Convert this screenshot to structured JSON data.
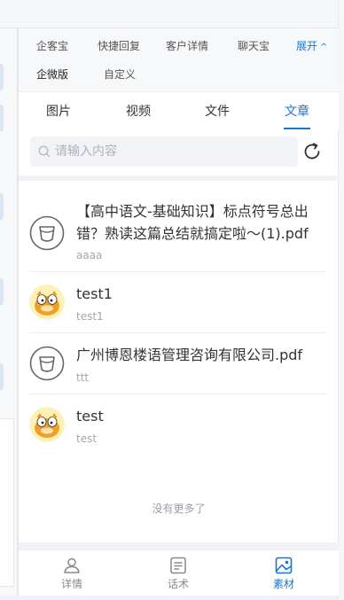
{
  "tools": {
    "row1": [
      "企客宝",
      "快捷回复",
      "客户详情",
      "聊天宝"
    ],
    "expand_label": "展开",
    "row2": [
      "企微版",
      "自定义"
    ]
  },
  "media_tabs": [
    "图片",
    "视频",
    "文件",
    "文章"
  ],
  "active_media_tab": "文章",
  "search": {
    "placeholder": "请输入内容",
    "value": ""
  },
  "items": [
    {
      "title": "【高中语文-基础知识】标点符号总出错？熟读这篇总结就搞定啦～(1).pdf",
      "subtitle": "aaaa",
      "avatar": "file-cup-icon"
    },
    {
      "title": "test1",
      "subtitle": "test1",
      "avatar": "garfield-avatar"
    },
    {
      "title": "广州博恩楼语管理咨询有限公司.pdf",
      "subtitle": "ttt",
      "avatar": "file-cup-icon"
    },
    {
      "title": "test",
      "subtitle": "test",
      "avatar": "garfield-avatar"
    }
  ],
  "no_more_text": "没有更多了",
  "bottom_nav": [
    {
      "label": "详情",
      "icon": "user-icon"
    },
    {
      "label": "话术",
      "icon": "script-icon"
    },
    {
      "label": "素材",
      "icon": "image-icon"
    }
  ],
  "active_bottom": "素材",
  "colors": {
    "accent": "#1677d2",
    "text": "#333333",
    "muted": "#a2a6ad"
  }
}
